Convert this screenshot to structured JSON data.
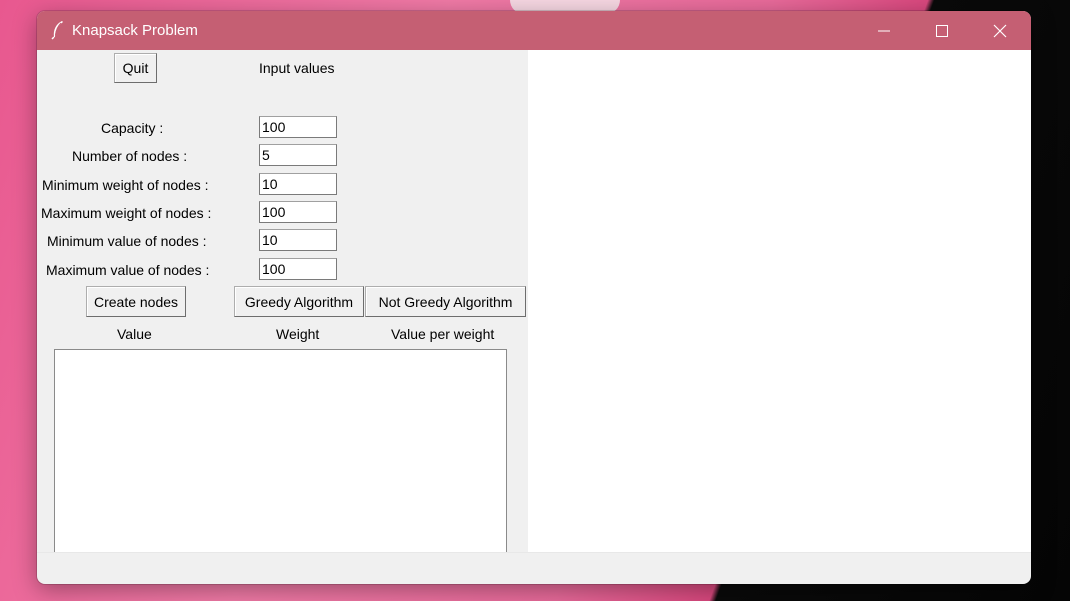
{
  "window": {
    "title": "Knapsack Problem",
    "controls": [
      "minimize-icon",
      "maximize-icon",
      "close-icon"
    ]
  },
  "toolbar": {
    "quit_label": "Quit",
    "input_values_label": "Input values"
  },
  "form": {
    "fields": [
      {
        "label": "Capacity :",
        "value": "100"
      },
      {
        "label": "Number of nodes :",
        "value": "5"
      },
      {
        "label": "Minimum weight of nodes :",
        "value": "10"
      },
      {
        "label": "Maximum weight of nodes :",
        "value": "100"
      },
      {
        "label": "Minimum value of nodes :",
        "value": "10"
      },
      {
        "label": "Maximum value of nodes :",
        "value": "100"
      }
    ]
  },
  "actions": {
    "create_nodes": "Create nodes",
    "greedy": "Greedy Algorithm",
    "not_greedy": "Not Greedy Algorithm"
  },
  "table": {
    "headers": [
      "Value",
      "Weight",
      "Value per weight"
    ],
    "rows": []
  },
  "colors": {
    "titlebar": "#c55f73",
    "window_bg": "#f0f0f0"
  }
}
